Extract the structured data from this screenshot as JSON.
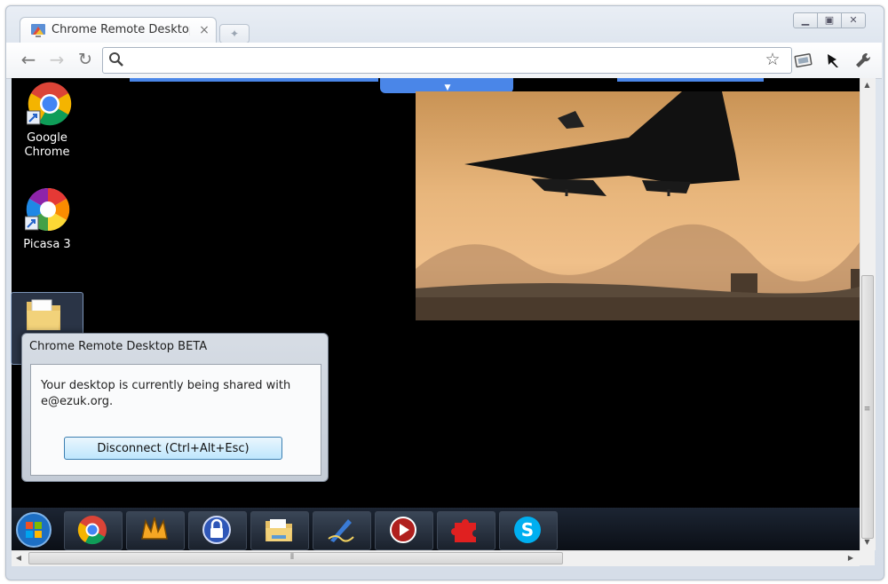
{
  "browser": {
    "tab": {
      "title": "Chrome Remote Desktop BETA",
      "close_glyph": "×",
      "favicon": "chrome-remote-desktop-icon"
    },
    "new_tab_glyph": "✦",
    "window_controls": {
      "minimize_glyph": "▁",
      "maximize_glyph": "▣",
      "close_glyph": "✕"
    },
    "toolbar": {
      "back_glyph": "←",
      "forward_glyph": "→",
      "reload_glyph": "↻",
      "omnibox_value": "",
      "search_icon": "⚲",
      "star_glyph": "☆",
      "extension_remote_glyph": "▱",
      "extension_pin_glyph": "✎",
      "wrench_glyph": "🔧"
    }
  },
  "remote_desktop": {
    "top_tab_arrow": "▼",
    "desktop_icons": [
      {
        "name": "google-chrome",
        "label_line1": "Google",
        "label_line2": "Chrome"
      },
      {
        "name": "picasa",
        "label": "Picasa 3"
      },
      {
        "name": "folder",
        "label": ""
      }
    ],
    "dialog": {
      "title": "Chrome Remote Desktop BETA",
      "message_line1": "Your desktop is currently being shared with",
      "message_line2": "e@ezuk.org.",
      "button": "Disconnect (Ctrl+Alt+Esc)"
    },
    "taskbar": {
      "items": [
        "start",
        "chrome",
        "winamp",
        "keepass",
        "explorer",
        "inkscape",
        "adobe-reader",
        "puzzle",
        "skype"
      ]
    }
  },
  "scrollbars": {
    "up": "▲",
    "down": "▼",
    "left": "◀",
    "right": "▶",
    "grip_v": "≡",
    "grip_h": "⦀"
  },
  "colors": {
    "accent_blue": "#4a86e8",
    "desktop_bg": "#000000",
    "taskbar": "#111820"
  }
}
